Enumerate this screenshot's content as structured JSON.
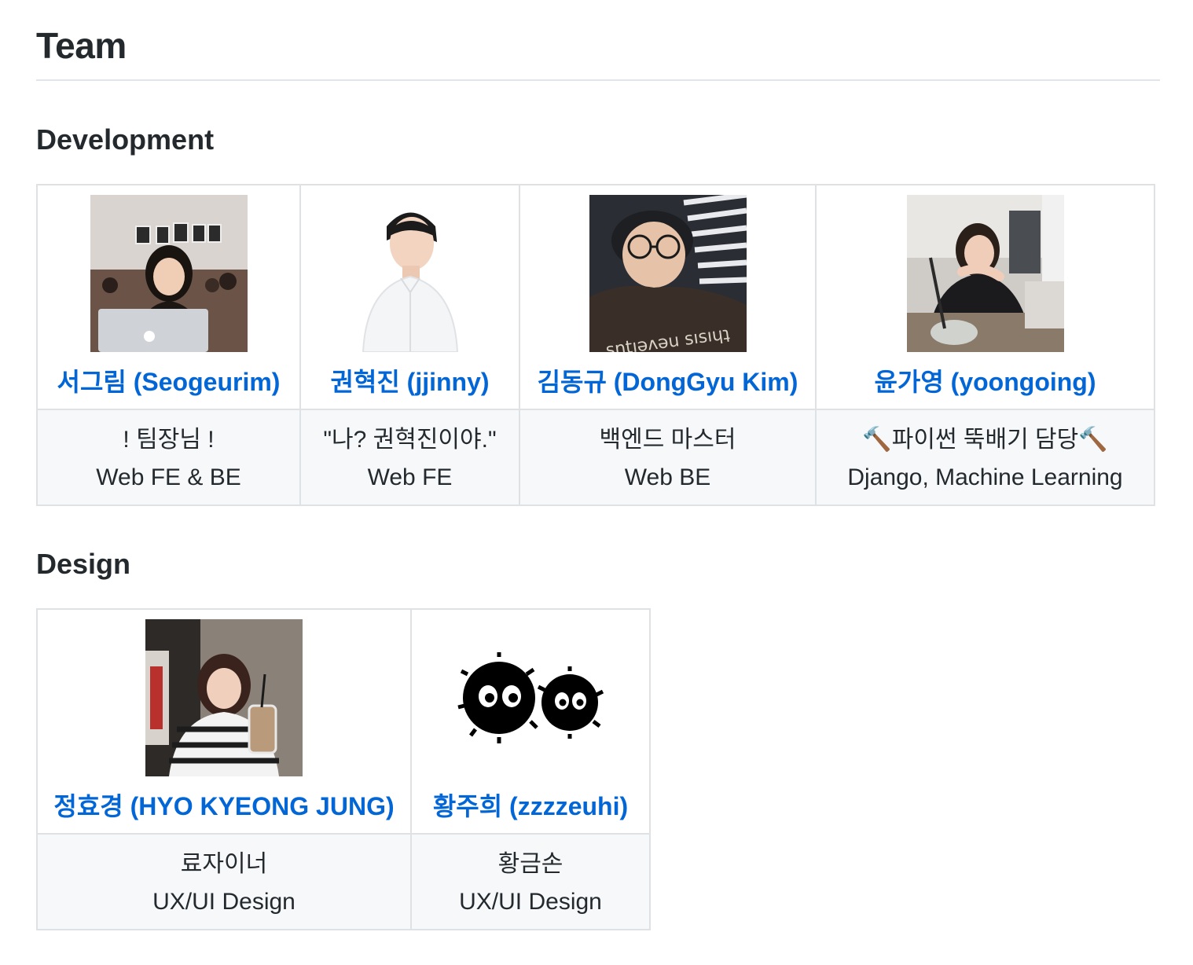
{
  "page": {
    "title": "Team"
  },
  "sections": [
    {
      "heading": "Development",
      "members": [
        {
          "name": "서그림 (Seogeurim)",
          "line1": "! 팀장님 !",
          "line2": "Web FE & BE"
        },
        {
          "name": "권혁진 (jjinny)",
          "line1": "\"나? 권혁진이야.\"",
          "line2": "Web FE"
        },
        {
          "name": "김동규 (DongGyu Kim)",
          "line1": "백엔드 마스터",
          "line2": "Web BE",
          "hoodie_text": "sntıəʌəu sısıɥʇ"
        },
        {
          "name": "윤가영 (yoongoing)",
          "line1": "🔨파이썬 뚝배기 담당🔨",
          "line2": "Django, Machine Learning"
        }
      ]
    },
    {
      "heading": "Design",
      "members": [
        {
          "name": "정효경 (HYO KYEONG JUNG)",
          "line1": "료자이너",
          "line2": "UX/UI Design"
        },
        {
          "name": "황주희 (zzzzeuhi)",
          "line1": "황금손",
          "line2": "UX/UI Design"
        }
      ]
    }
  ],
  "colors": {
    "link": "#0366d6",
    "text": "#24292e",
    "border": "#dfe2e5",
    "row_bg": "#f6f8fa"
  }
}
